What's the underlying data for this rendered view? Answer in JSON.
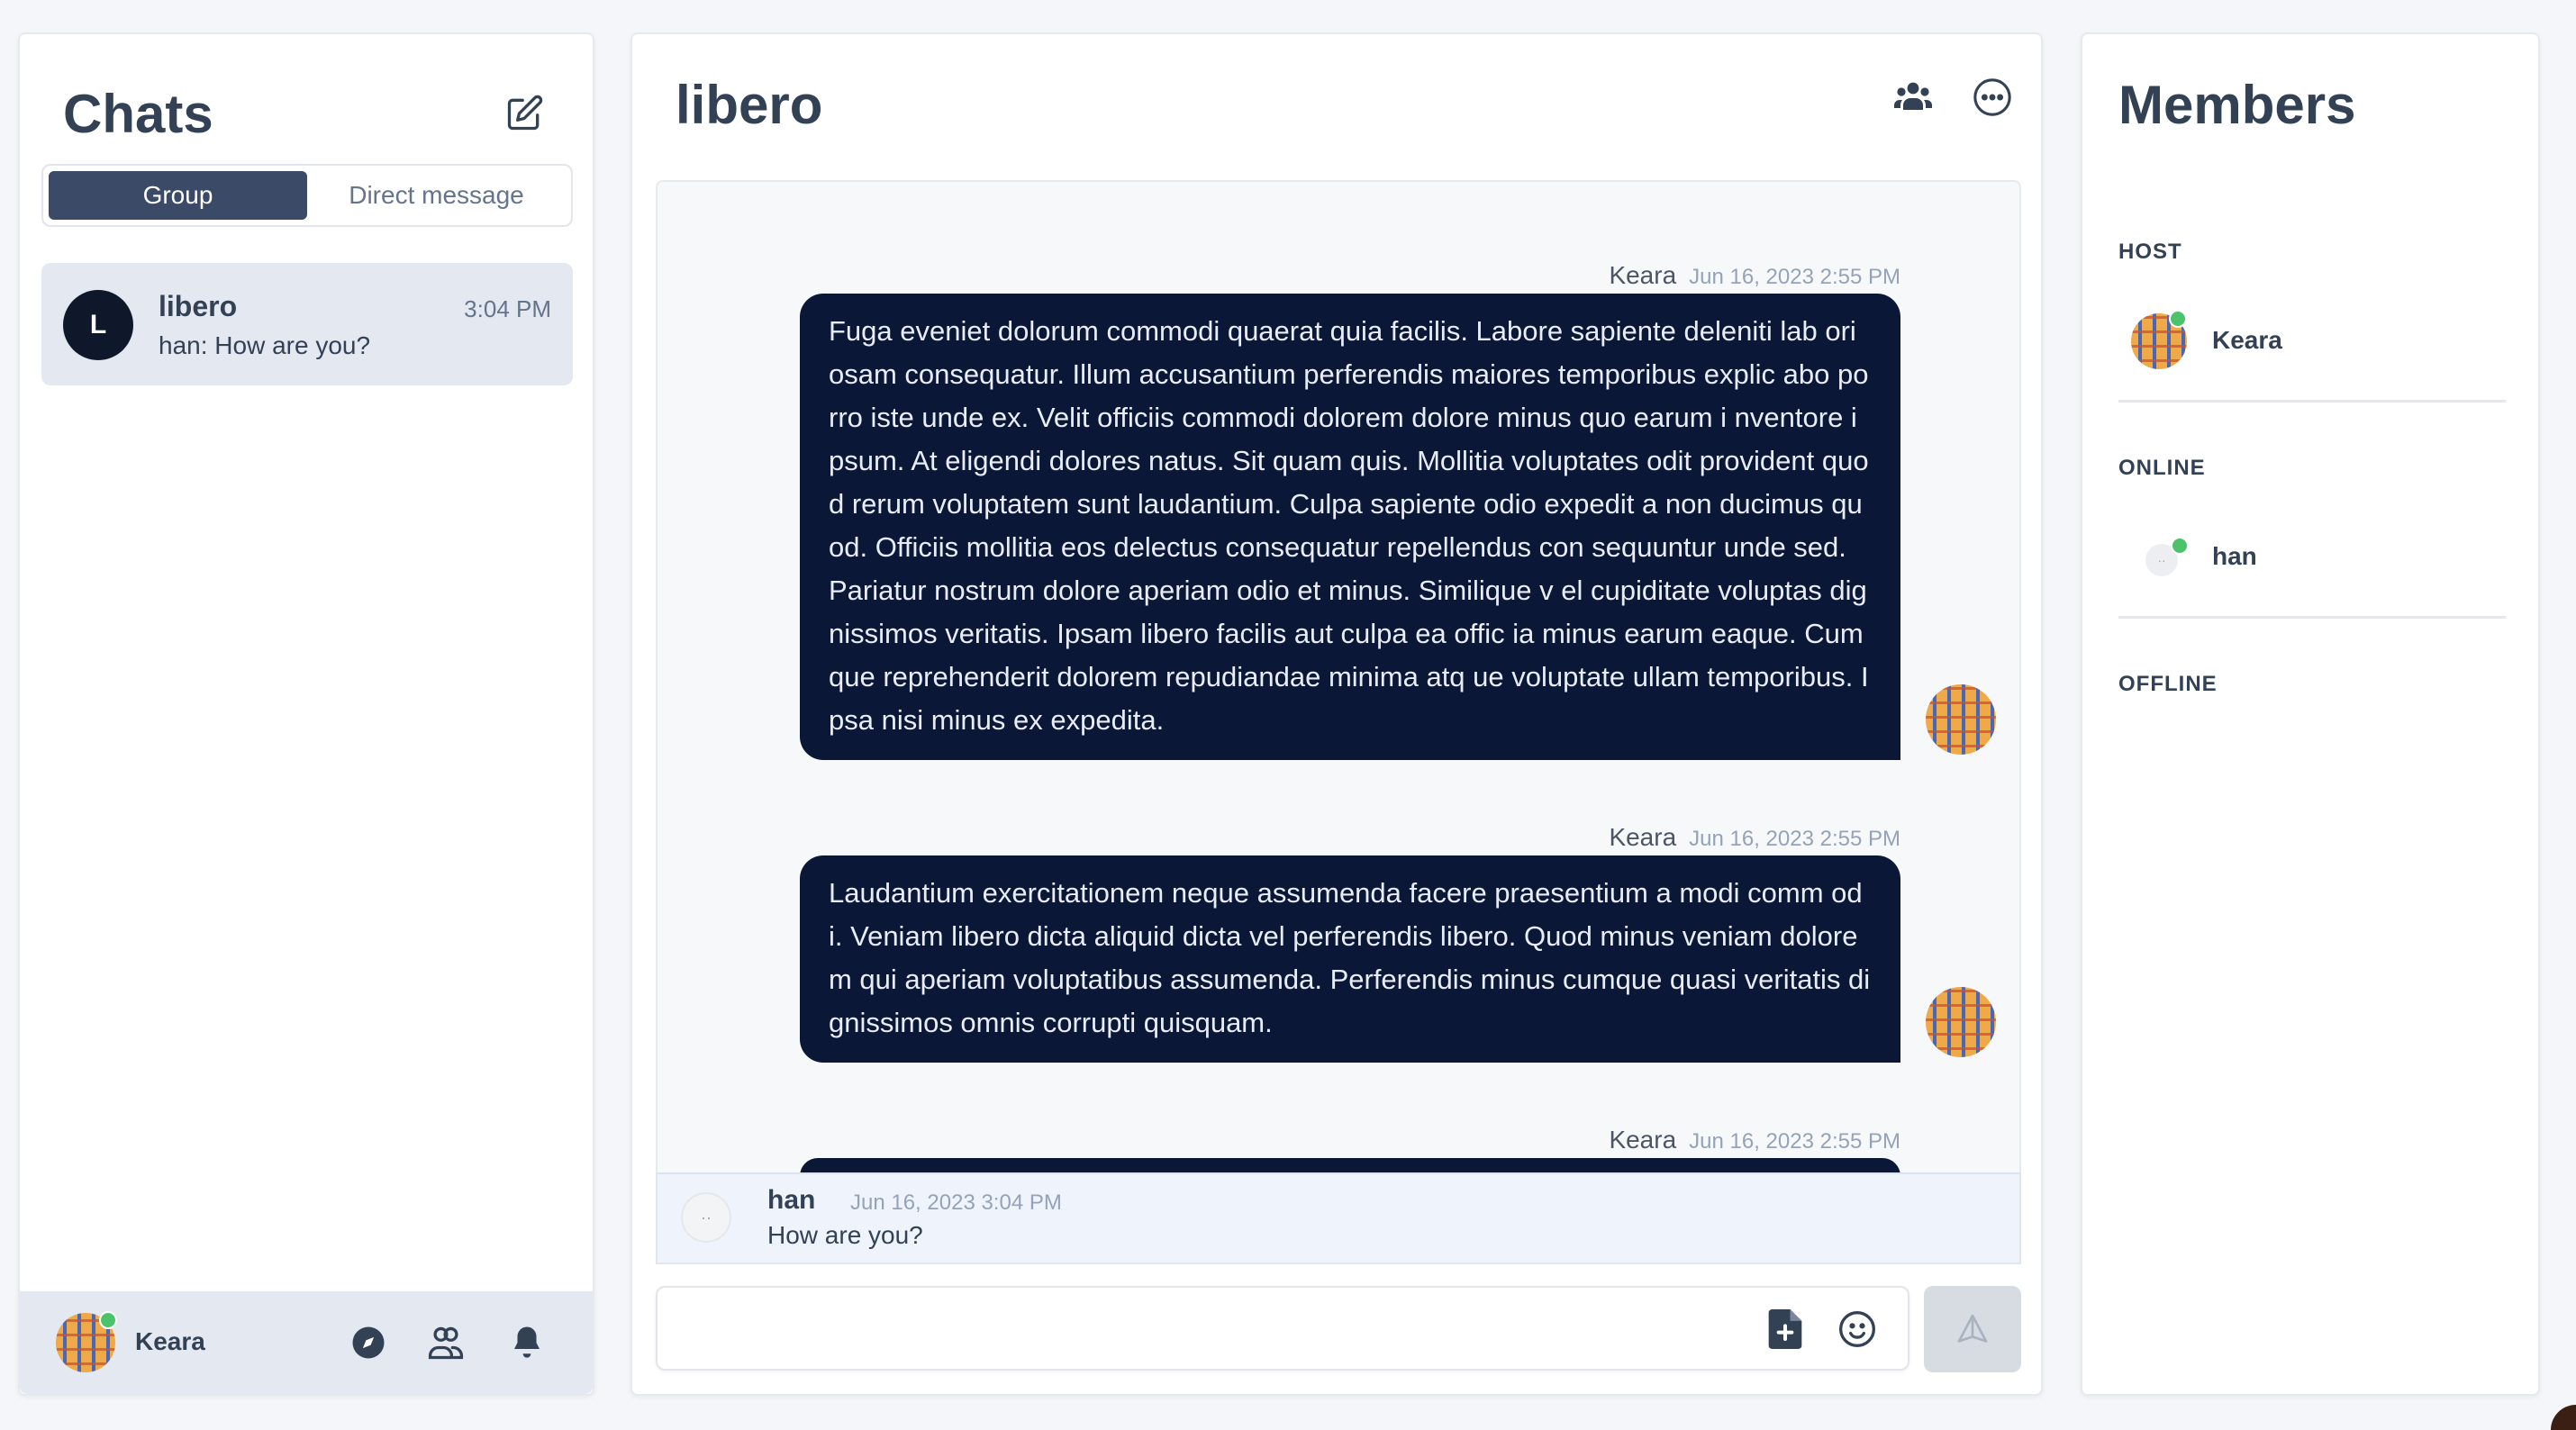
{
  "sidebar": {
    "title": "Chats",
    "compose_icon": "edit-icon",
    "tabs": [
      {
        "label": "Group",
        "active": true
      },
      {
        "label": "Direct message",
        "active": false
      }
    ],
    "chats": [
      {
        "avatar_letter": "L",
        "name": "libero",
        "time": "3:04 PM",
        "preview": "han: How are you?"
      }
    ],
    "user": {
      "name": "Keara",
      "icons": [
        "compass-icon",
        "contacts-icon",
        "bell-icon"
      ]
    }
  },
  "conversation": {
    "title": "libero",
    "header_icons": [
      "members-icon",
      "more-icon"
    ],
    "messages": [
      {
        "author": "Keara",
        "timestamp": "Jun 16, 2023 2:55 PM",
        "text": "Fuga eveniet dolorum commodi quaerat quia facilis. Labore sapiente deleniti lab oriosam consequatur. Illum accusantium perferendis maiores temporibus explic abo porro iste unde ex. Velit officiis commodi dolorem dolore minus quo earum i nventore ipsum. At eligendi dolores natus. Sit quam quis. Mollitia voluptates odit provident quod rerum voluptatem sunt laudantium. Culpa sapiente odio expedit a non ducimus quod. Officiis mollitia eos delectus consequatur repellendus con sequuntur unde sed. Pariatur nostrum dolore aperiam odio et minus. Similique v el cupiditate voluptas dignissimos veritatis. Ipsam libero facilis aut culpa ea offic ia minus earum eaque. Cumque reprehenderit dolorem repudiandae minima atq ue voluptate ullam temporibus. Ipsa nisi minus ex expedita."
      },
      {
        "author": "Keara",
        "timestamp": "Jun 16, 2023 2:55 PM",
        "text": "Laudantium exercitationem neque assumenda facere praesentium a modi comm odi. Veniam libero dicta aliquid dicta vel perferendis libero. Quod minus veniam dolorem qui aperiam voluptatibus assumenda. Perferendis minus cumque quasi veritatis dignissimos omnis corrupti quisquam."
      },
      {
        "author": "Keara",
        "timestamp": "Jun 16, 2023 2:55 PM",
        "text": ""
      }
    ],
    "pinned": {
      "author": "han",
      "timestamp": "Jun 16, 2023 3:04 PM",
      "text": "How are you?"
    },
    "composer": {
      "value": "",
      "placeholder": "",
      "icons": [
        "file-plus-icon",
        "emoji-icon",
        "send-icon"
      ]
    }
  },
  "members": {
    "title": "Members",
    "sections": [
      {
        "label": "HOST",
        "members": [
          {
            "name": "Keara",
            "online": true
          }
        ]
      },
      {
        "label": "ONLINE",
        "members": [
          {
            "name": "han",
            "online": true
          }
        ]
      },
      {
        "label": "OFFLINE",
        "members": []
      }
    ]
  },
  "colors": {
    "bubble": "#0b1736",
    "active_tab": "#3b4a66",
    "online": "#4cc26a",
    "selected_chat": "#e4e8f1"
  }
}
